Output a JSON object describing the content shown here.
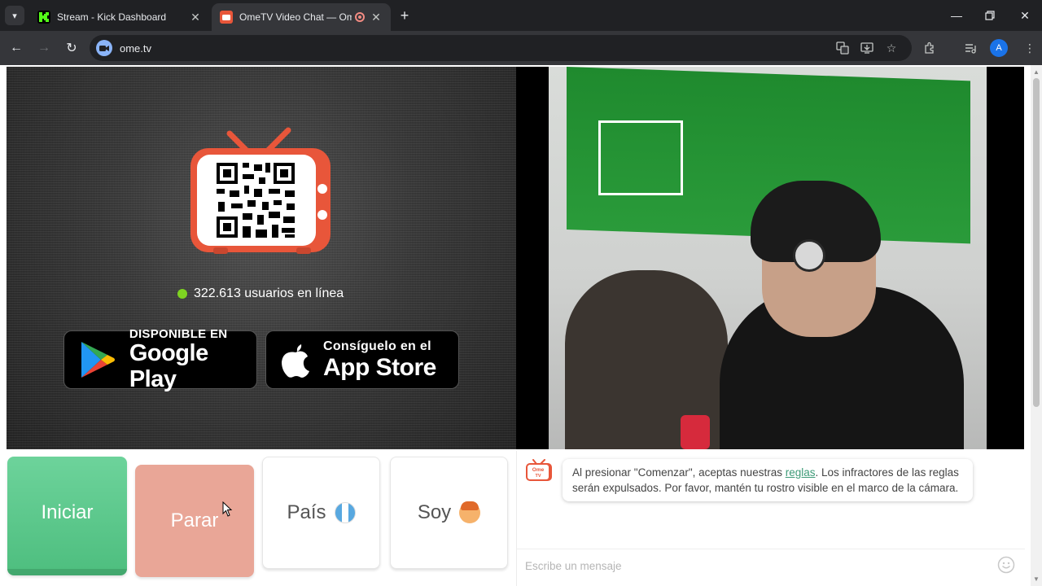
{
  "browser": {
    "tabs": [
      {
        "title": "Stream - Kick Dashboard",
        "favicon": "kick-logo-icon",
        "active": false
      },
      {
        "title": "OmeTV Video Chat — Ome",
        "favicon": "ometv-tv-icon",
        "active": true
      }
    ],
    "url": "ome.tv",
    "profile_initial": "A"
  },
  "left_pane": {
    "online_count": "322.613 usuarios en línea",
    "google_play": {
      "small": "DISPONIBLE EN",
      "big": "Google Play"
    },
    "app_store": {
      "small": "Consíguelo en el",
      "big": "App Store"
    }
  },
  "controls": {
    "start": "Iniciar",
    "stop": "Parar",
    "country": "País",
    "gender": "Soy"
  },
  "chat": {
    "logo_text_top": "Ome",
    "logo_text_bottom": "TV",
    "notice_before": "Al presionar \"Comenzar\", aceptas nuestras ",
    "notice_link": "reglas",
    "notice_after": ". Los infractores de las reglas serán expulsados. Por favor, mantén tu rostro visible en el marco de la cámara.",
    "input_placeholder": "Escribe un mensaje"
  },
  "colors": {
    "accent_green": "#4fbf80",
    "stop_salmon": "#e9a697",
    "brand_orange": "#e8563a",
    "online_dot": "#7ed321",
    "link": "#3d9a77"
  }
}
